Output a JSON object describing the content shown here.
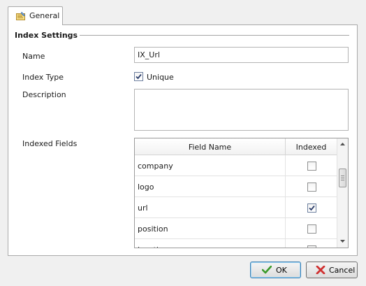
{
  "tabs": [
    {
      "label": "General",
      "icon": "properties-icon"
    }
  ],
  "section": {
    "title": "Index Settings"
  },
  "form": {
    "name_label": "Name",
    "name_value": "IX_Url",
    "index_type_label": "Index Type",
    "unique_label": "Unique",
    "unique_checked": true,
    "description_label": "Description",
    "description_value": "",
    "indexed_fields_label": "Indexed Fields"
  },
  "grid": {
    "columns": [
      "Field Name",
      "Indexed"
    ],
    "rows": [
      {
        "field": "company",
        "indexed": false
      },
      {
        "field": "logo",
        "indexed": false
      },
      {
        "field": "url",
        "indexed": true
      },
      {
        "field": "position",
        "indexed": false
      },
      {
        "field": "location",
        "indexed": false
      }
    ]
  },
  "buttons": {
    "ok_label": "OK",
    "cancel_label": "Cancel"
  },
  "colors": {
    "ok_check": "#3a9a2a",
    "cancel_x": "#d03030",
    "checkbox_mark": "#2c3e6b"
  }
}
